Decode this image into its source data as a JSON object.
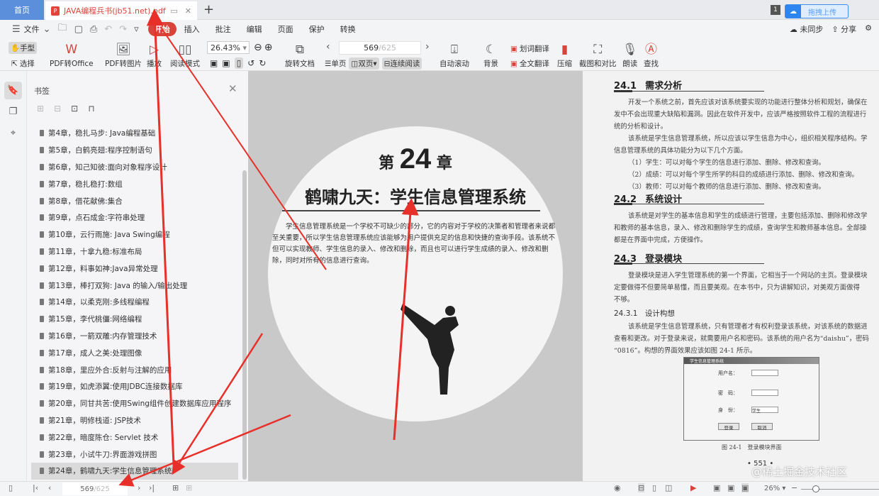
{
  "tabs": {
    "home": "首页",
    "doc_title": "JAVA编程兵书(jb51.net).pdf",
    "badge": "1",
    "upload": "拖拽上传"
  },
  "menu": {
    "file": "文件",
    "items": [
      "开始",
      "插入",
      "批注",
      "编辑",
      "页面",
      "保护",
      "转换"
    ],
    "sync": "未同步",
    "share": "分享"
  },
  "toolbar": {
    "hand": "手型",
    "select": "选择",
    "pdf_office": "PDF转Office",
    "pdf_image": "PDF转图片",
    "play": "播放",
    "read_mode": "阅读模式",
    "zoom": "26.43%",
    "rotate": "旋转文档",
    "page_current": "569",
    "page_total": "/625",
    "single": "单页",
    "double": "双页",
    "continuous": "连续阅读",
    "autoscroll": "自动滚动",
    "background": "背景",
    "word_translate": "划词翻译",
    "full_translate": "全文翻译",
    "compress": "压缩",
    "screenshot": "截图和对比",
    "read_aloud": "朗读",
    "find": "查找"
  },
  "sidebar": {
    "title": "书签",
    "bookmarks": [
      "第4章，稳扎马步: Java编程基础",
      "第5章，白鹤亮翅:程序控制语句",
      "第6章，知己知彼:面向对象程序设计",
      "第7章，稳扎稳打:数组",
      "第8章，借花献佛:集合",
      "第9章，点石成金:字符串处理",
      "第10章，云行雨施: Java Swing编程",
      "第11章，十拿九稳:标准布局",
      "第12章，料事如神:Java异常处理",
      "第13章，棒打双狗: Java 的输入/输出处理",
      "第14章，以柔克刚:多线程编程",
      "第15章，李代桃僵:网络编程",
      "第16章，一箭双雕:内存管理技术",
      "第17章，成人之美:处理图像",
      "第18章，里应外合:反射与注解的应用",
      "第19章，如虎添翼:使用JDBC连接数据库",
      "第20章，同甘共苦:使用Swing组件创建数据库应用程序",
      "第21章，明修栈道: JSP技术",
      "第22章，暗度陈仓: Servlet 技术",
      "第23章，小试牛刀:界面游戏拼图",
      "第24章，鹤啸九天:学生信息管理系统"
    ]
  },
  "left_page": {
    "chapter_prefix": "第",
    "chapter_num": "24",
    "chapter_suffix": "章",
    "title": "鹤啸九天：学生信息管理系统",
    "intro": "学生信息管理系统是一个学校不可缺少的部分，它的内容对于学校的决策者和管理者来说都至关重要，所以学生信息管理系统应该能够为用户提供充足的信息和快捷的查询手段。该系统不但可以实现教师、学生信息的录入、修改和删除，而且也可以进行学生成绩的录入、修改和删除，同时对所有的信息进行查询。"
  },
  "right_page": {
    "s1": {
      "num": "24.1",
      "title": "需求分析"
    },
    "s1_p": [
      "开发一个系统之前，首先应该对该系统要实现的功能进行整体分析和规划，确保在",
      "发中不会出现重大缺陷和漏洞。因此在软件开发中，应该严格按照软件工程的流程进行",
      "统的分析和设计。",
      "该系统是学生信息管理系统，所以应该以学生信息为中心，组织相关程序结构。学",
      "信息管理系统的具体功能分为以下几个方面。",
      "（1）学生：可以对每个学生的信息进行添加、删除、修改和查询。",
      "（2）成绩：可以对每个学生所学的科目的成绩进行添加、删除、修改和查询。",
      "（3）教师：可以对每个教师的信息进行添加、删除、修改和查询。"
    ],
    "s2": {
      "num": "24.2",
      "title": "系统设计"
    },
    "s2_p": [
      "该系统是对学生的基本信息和学生的成绩进行管理，主要包括添加、删除和修改学",
      "和教师的基本信息，录入、修改和删除学生的成绩，查询学生和教师基本信息。全部操",
      "都是在界面中完成，方便操作。"
    ],
    "s3": {
      "num": "24.3",
      "title": "登录模块"
    },
    "s3_p": [
      "登录模块是进入学生管理系统的第一个界面，它相当于一个网站的主页。登录模块",
      "定要做得不但要简单易懂，而且要美观。在本书中，只为讲解知识，对美观方面做得",
      "不够。"
    ],
    "s31": "24.3.1　设计构想",
    "s31_p": [
      "该系统是学生信息管理系统，只有管理者才有权利登录该系统，对该系统的数据进",
      "查看和更改。对于登录来说，就需要用户名和密码。该系统的用户名为“daishu”，密码",
      "“0816”。构想的界面效果应该如图 24-1 所示。"
    ],
    "figure": {
      "window_title": "学生信息管理系统",
      "username": "用户名：",
      "password": "密　码：",
      "role": "身　份：",
      "role_value": "学生",
      "login": "登录",
      "cancel": "取消",
      "caption": "图 24-1　登录模块界面"
    },
    "page_number": "• 551 •"
  },
  "watermark": "@稀土掘金技术社区",
  "status": {
    "page_current": "569",
    "page_total": "/625",
    "zoom": "26%"
  },
  "colors": {
    "accent": "#d9443a",
    "home_tab": "#5b8fdc",
    "arrow": "#e8302a"
  }
}
